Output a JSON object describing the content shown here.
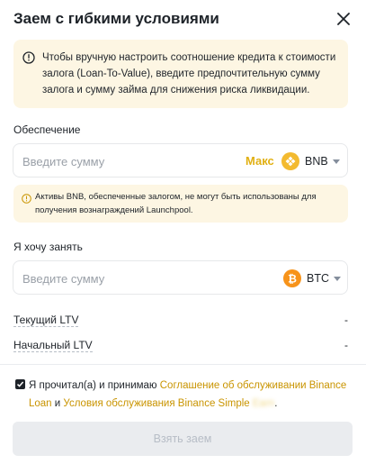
{
  "dialog": {
    "title": "Заем с гибкими условиями"
  },
  "notice": {
    "text": "Чтобы вручную настроить соотношение кредита к стоимости залога (Loan-To-Value), введите предпочтительную сумму залога и сумму займа для снижения риска ликвидации."
  },
  "collateral": {
    "label": "Обеспечение",
    "placeholder": "Введите сумму",
    "max_label": "Макс",
    "coin": "BNB",
    "coin_color": "#f3ba2f"
  },
  "warning": {
    "text": "Активы BNB, обеспеченные залогом, не могут быть использованы для получения вознаграждений Launchpool."
  },
  "borrow": {
    "label": "Я хочу занять",
    "placeholder": "Введите сумму",
    "coin": "BTC",
    "coin_color": "#f7931a"
  },
  "ltv": {
    "current_label": "Текущий LTV",
    "current_value": "-",
    "initial_label": "Начальный LTV",
    "initial_value": "-"
  },
  "agreement": {
    "checked": true,
    "prefix": "Я прочитал(а) и принимаю ",
    "link1": "Соглашение об обслуживании Binance Loan",
    "middle": " и ",
    "link2": "Условия обслуживания Binance Simple",
    "link2_hidden": "Earn",
    "suffix": "."
  },
  "submit": {
    "label": "Взять заем"
  },
  "colors": {
    "accent": "#c99400",
    "notice_bg": "#fdf6e3",
    "text": "#1e2329"
  }
}
